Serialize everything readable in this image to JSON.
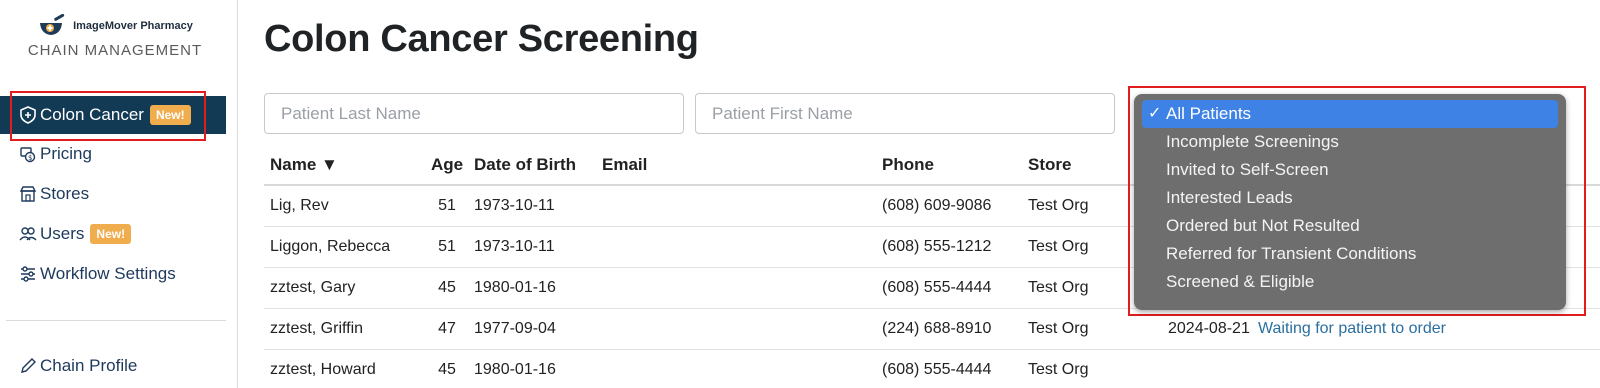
{
  "brand": {
    "name": "ImageMover Pharmacy",
    "subtitle": "CHAIN MANAGEMENT"
  },
  "sidebar": {
    "items": [
      {
        "label": "Colon Cancer",
        "badge": "New!",
        "icon": "shield-plus-icon",
        "active": true
      },
      {
        "label": "Pricing",
        "icon": "price-tag-icon"
      },
      {
        "label": "Stores",
        "icon": "store-icon"
      },
      {
        "label": "Users",
        "badge": "New!",
        "icon": "users-icon"
      },
      {
        "label": "Workflow Settings",
        "icon": "sliders-icon"
      }
    ],
    "bottom": {
      "label": "Chain Profile",
      "icon": "pencil-icon"
    }
  },
  "main": {
    "title": "Colon Cancer Screening",
    "filters": {
      "last_name_placeholder": "Patient Last Name",
      "first_name_placeholder": "Patient First Name"
    },
    "table": {
      "headers": {
        "name": "Name ▼",
        "age": "Age",
        "dob": "Date of Birth",
        "email": "Email",
        "phone": "Phone",
        "store": "Store"
      },
      "rows": [
        {
          "name": "Lig, Rev",
          "age": "51",
          "dob": "1973-10-11",
          "phone": "(608) 609-9086",
          "store": "Test Org",
          "date": "",
          "status": ""
        },
        {
          "name": "Liggon, Rebecca",
          "age": "51",
          "dob": "1973-10-11",
          "phone": "(608) 555-1212",
          "store": "Test Org",
          "date": "",
          "status": ""
        },
        {
          "name": "zztest, Gary",
          "age": "45",
          "dob": "1980-01-16",
          "phone": "(608) 555-4444",
          "store": "Test Org",
          "date": "",
          "status": ""
        },
        {
          "name": "zztest, Griffin",
          "age": "47",
          "dob": "1977-09-04",
          "phone": "(224) 688-8910",
          "store": "Test Org",
          "date": "2024-08-21",
          "status": "Waiting for patient to order"
        },
        {
          "name": "zztest, Howard",
          "age": "45",
          "dob": "1980-01-16",
          "phone": "(608) 555-4444",
          "store": "Test Org",
          "date": "",
          "status": ""
        }
      ]
    },
    "patient_filter": {
      "selected": "All Patients",
      "options": [
        "All Patients",
        "Incomplete Screenings",
        "Invited to Self-Screen",
        "Interested Leads",
        "Ordered but Not Resulted",
        "Referred for Transient Conditions",
        "Screened & Eligible"
      ],
      "check": "✓"
    }
  },
  "colors": {
    "nav_active_bg": "#133a55",
    "badge": "#f0ad4e",
    "highlight": "#e11d1d",
    "dropdown_bg": "#6e6e6e",
    "dropdown_selected": "#3f82e6",
    "link": "#2a6fa0"
  }
}
